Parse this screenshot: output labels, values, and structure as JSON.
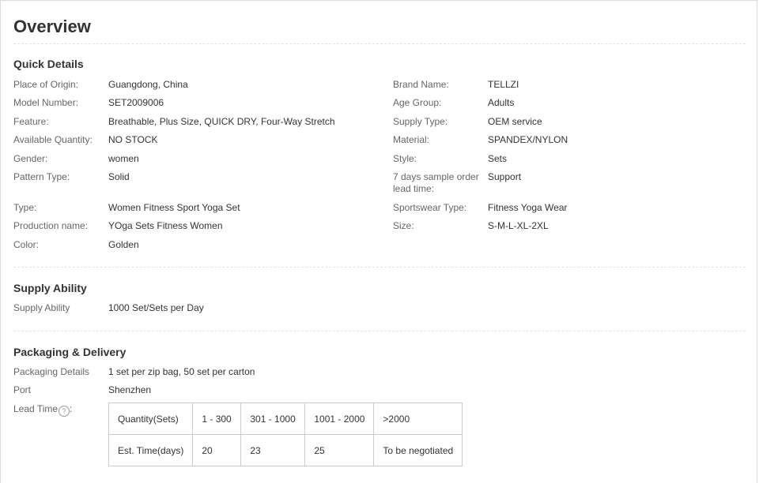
{
  "overview": {
    "title": "Overview"
  },
  "quick_details": {
    "title": "Quick Details",
    "left": [
      {
        "label": "Place of Origin:",
        "value": "Guangdong, China"
      },
      {
        "label": "Model Number:",
        "value": "SET2009006"
      },
      {
        "label": "Feature:",
        "value": "Breathable, Plus Size, QUICK DRY, Four-Way Stretch"
      },
      {
        "label": "Available Quantity:",
        "value": "NO STOCK"
      },
      {
        "label": "Gender:",
        "value": "women"
      },
      {
        "label": "Pattern Type:",
        "value": "Solid"
      },
      {
        "label": "Type:",
        "value": "Women Fitness Sport Yoga Set"
      },
      {
        "label": "Production name:",
        "value": "YOga Sets Fitness Women"
      },
      {
        "label": "Color:",
        "value": "Golden"
      }
    ],
    "right": [
      {
        "label": "Brand Name:",
        "value": "TELLZI"
      },
      {
        "label": "Age Group:",
        "value": "Adults"
      },
      {
        "label": "Supply Type:",
        "value": "OEM service"
      },
      {
        "label": "Material:",
        "value": "SPANDEX/NYLON"
      },
      {
        "label": "Style:",
        "value": "Sets"
      },
      {
        "label": "7 days sample order lead time:",
        "value": "Support"
      },
      {
        "label": "Sportswear Type:",
        "value": "Fitness Yoga Wear"
      },
      {
        "label": "Size:",
        "value": "S-M-L-XL-2XL"
      }
    ]
  },
  "supply_ability": {
    "title": "Supply Ability",
    "label": "Supply Ability",
    "value": "1000 Set/Sets per Day"
  },
  "packaging": {
    "title": "Packaging & Delivery",
    "details_label": "Packaging Details",
    "details_value": "1 set per zip bag, 50 set per carton",
    "port_label": "Port",
    "port_value": "Shenzhen",
    "lead_time_label": "Lead Time",
    "lead_time_colon": ":",
    "help_glyph": "?",
    "help_icon": "question-circle-icon",
    "lead_table": {
      "header_row": [
        "Quantity(Sets)",
        "1 - 300",
        "301 - 1000",
        "1001 - 2000",
        ">2000"
      ],
      "time_row": [
        "Est. Time(days)",
        "20",
        "23",
        "25",
        "To be negotiated"
      ]
    }
  },
  "colors": {
    "label": "#666666",
    "value": "#333333",
    "border": "#cccccc",
    "divider": "#e4e4e4"
  }
}
